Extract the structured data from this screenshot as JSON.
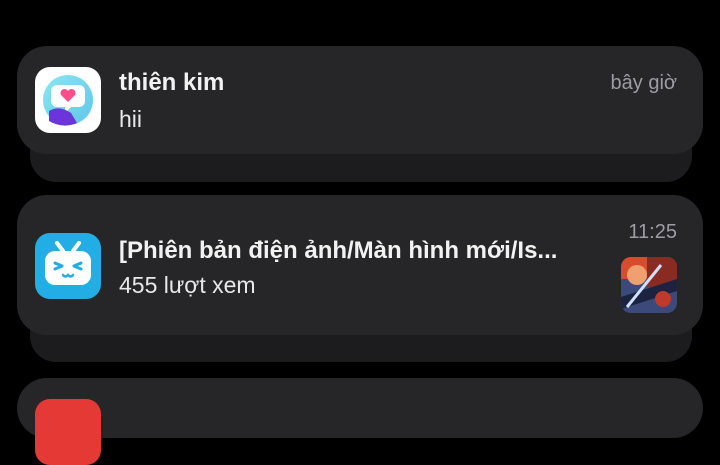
{
  "notifications": [
    {
      "app_icon": "heart-chat-app-icon",
      "title": "thiên kim",
      "body": "hii",
      "time": "bây giờ"
    },
    {
      "app_icon": "bilibili-tv-icon",
      "title": "[Phiên bản điện ảnh/Màn hình mới/Is...",
      "body": "455 lượt xem",
      "time": "11:25",
      "thumbnail": "video-thumbnail"
    }
  ],
  "colors": {
    "background": "#000000",
    "card": "#262628",
    "stacked_card": "#1c1c1e",
    "secondary_text": "#9d9da2",
    "bilibili_blue": "#23ade5"
  }
}
